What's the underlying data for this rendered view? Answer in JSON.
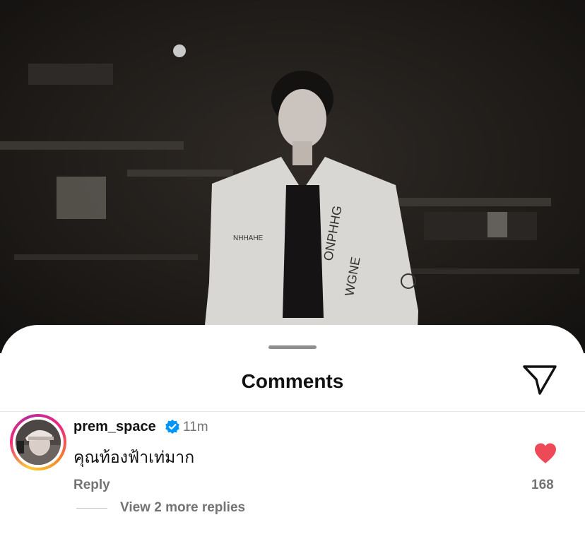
{
  "sheet": {
    "title": "Comments"
  },
  "comments": [
    {
      "username": "prem_space",
      "verified": true,
      "time": "11m",
      "text": "คุณท้องฟ้าเท่มาก",
      "reply_label": "Reply",
      "likes": "168",
      "liked": true,
      "view_replies_label": "View 2 more replies"
    }
  ],
  "colors": {
    "heart": "#ed4956",
    "verified": "#0095f6",
    "secondary_text": "#737373",
    "photo_background": "#1d1a17"
  },
  "icons": {
    "share": "paper-plane-icon",
    "heart": "heart-filled-icon",
    "verified": "verified-badge-icon"
  }
}
